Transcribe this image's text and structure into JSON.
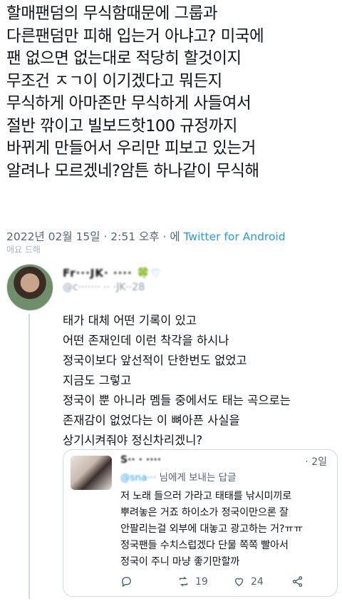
{
  "main_tweet": {
    "lines": [
      "할매팬덤의 무식함때문에 그룹과",
      "다른팬덤만 피해 입는거 아냐고? 미국에",
      "팬 없으면 없는대로 적당히 할것이지",
      "무조건 ㅈㄱ이 이기겠다고 뭐든지",
      "무식하게 아마존만 무식하게 사들여서",
      "절반 깎이고 빌보드핫100 규정까지",
      "바뀌게 만들어서 우리만 피보고 있는거",
      "알려나 모르겠네?암튼 하나같이 무식해"
    ],
    "meta_date": "2022년 02월 15일 · 2:51 오후 · 에 ",
    "meta_source": "Twitter for Android",
    "cut_text": "애요 드해"
  },
  "reply": {
    "name_blurred": "Fr···JK· ···· ",
    "handle_blurred": "@c······· ·· ·JK··28",
    "lines": [
      "태가 대체 어떤 기록이  있고",
      "어떤 존재인데 이런 착각을 하시나",
      "정국이보다 앞선적이  단한번도 없었고",
      "지금도  그렇고",
      "정국이 뿐 아니라 멤들 중에서도 태는 곡으로는",
      "존재감이  없었다는  이  뼈아픈 사실을",
      "상기시켜줘야  정신차리겠니?"
    ]
  },
  "quote": {
    "name_blurred": "S·· · ····",
    "time": "· 2일",
    "mention_blurred": "@sna···",
    "to_label": "님에게 보내는 답글",
    "lines": [
      "저 노래 들으러 가라고 태태를 낚시미끼로",
      "뿌려놓은 거죠 하이소가 정국이만으론 잘",
      "안팔리는걸 외부에 대놓고 광고하는 거?ㅠㅠ",
      "정국팬들 수치스럽겠다 단물 쪽쪽 빨아서",
      "정국이 주니 마냥 좋기만할까"
    ],
    "actions": {
      "reply_icon": "comment-icon",
      "retweet_icon": "retweet-icon",
      "retweet_count": "19",
      "like_icon": "heart-icon",
      "like_count": "24",
      "share_icon": "share-icon"
    }
  },
  "colors": {
    "link": "#1d9bf0",
    "meta": "#536471",
    "border": "#cfd9de"
  }
}
